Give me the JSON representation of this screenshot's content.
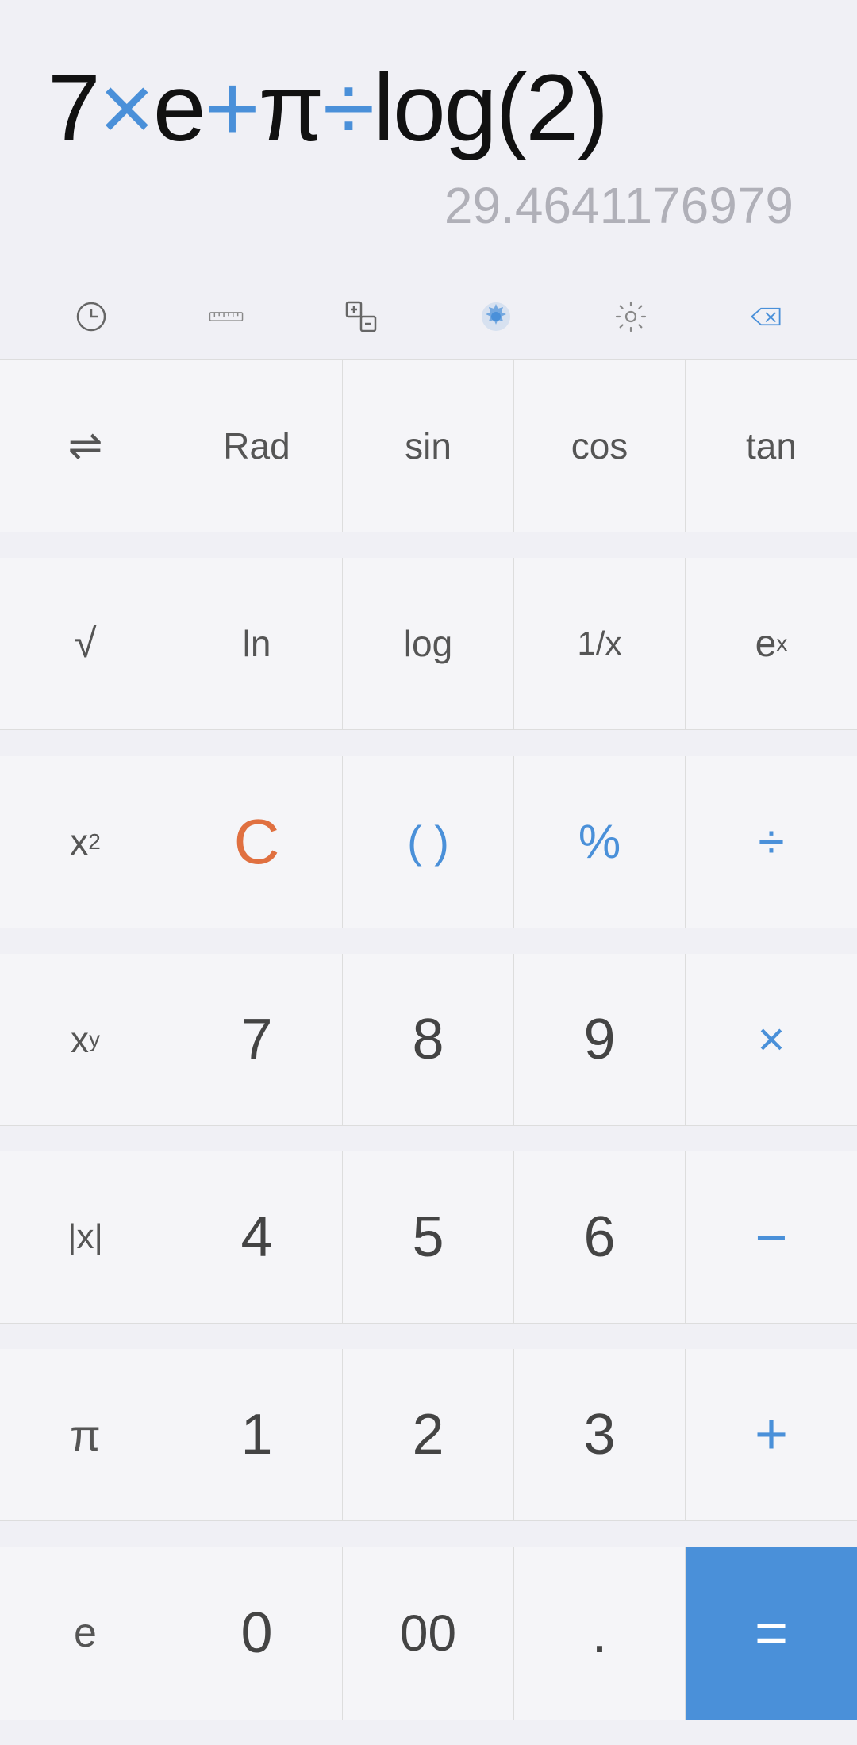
{
  "display": {
    "expression": "7×e+π÷log(2)",
    "result": "29.4641176979"
  },
  "toolbar": {
    "icons": [
      {
        "name": "history-icon",
        "label": "History"
      },
      {
        "name": "ruler-icon",
        "label": "Ruler/Unit"
      },
      {
        "name": "plusminus-icon",
        "label": "Plus Minus"
      },
      {
        "name": "theme-icon",
        "label": "Theme"
      },
      {
        "name": "settings-icon",
        "label": "Settings"
      },
      {
        "name": "backspace-icon",
        "label": "Backspace"
      }
    ]
  },
  "keyboard": {
    "rows": [
      [
        {
          "label": "⇌",
          "type": "symbol",
          "name": "convert-key"
        },
        {
          "label": "Rad",
          "type": "text",
          "name": "rad-key"
        },
        {
          "label": "sin",
          "type": "text",
          "name": "sin-key"
        },
        {
          "label": "cos",
          "type": "text",
          "name": "cos-key"
        },
        {
          "label": "tan",
          "type": "text",
          "name": "tan-key"
        }
      ],
      [
        {
          "label": "√",
          "type": "symbol",
          "name": "sqrt-key"
        },
        {
          "label": "ln",
          "type": "text",
          "name": "ln-key"
        },
        {
          "label": "log",
          "type": "text",
          "name": "log-key"
        },
        {
          "label": "1/x",
          "type": "text",
          "name": "reciprocal-key"
        },
        {
          "label": "eˣ",
          "type": "text",
          "name": "exp-key"
        }
      ],
      [
        {
          "label": "x²",
          "type": "symbol",
          "name": "square-key"
        },
        {
          "label": "C",
          "type": "clear",
          "name": "clear-key"
        },
        {
          "label": "( )",
          "type": "blue",
          "name": "paren-key"
        },
        {
          "label": "%",
          "type": "blue",
          "name": "percent-key"
        },
        {
          "label": "÷",
          "type": "blue",
          "name": "divide-key"
        }
      ],
      [
        {
          "label": "xʸ",
          "type": "symbol",
          "name": "power-key"
        },
        {
          "label": "7",
          "type": "number",
          "name": "seven-key"
        },
        {
          "label": "8",
          "type": "number",
          "name": "eight-key"
        },
        {
          "label": "9",
          "type": "number",
          "name": "nine-key"
        },
        {
          "label": "×",
          "type": "blue",
          "name": "multiply-key"
        }
      ],
      [
        {
          "label": "|x|",
          "type": "symbol",
          "name": "abs-key"
        },
        {
          "label": "4",
          "type": "number",
          "name": "four-key"
        },
        {
          "label": "5",
          "type": "number",
          "name": "five-key"
        },
        {
          "label": "6",
          "type": "number",
          "name": "six-key"
        },
        {
          "label": "−",
          "type": "blue",
          "name": "minus-key"
        }
      ],
      [
        {
          "label": "π",
          "type": "symbol",
          "name": "pi-key"
        },
        {
          "label": "1",
          "type": "number",
          "name": "one-key"
        },
        {
          "label": "2",
          "type": "number",
          "name": "two-key"
        },
        {
          "label": "3",
          "type": "number",
          "name": "three-key"
        },
        {
          "label": "+",
          "type": "blue",
          "name": "plus-key"
        }
      ],
      [
        {
          "label": "e",
          "type": "symbol",
          "name": "euler-key"
        },
        {
          "label": "0",
          "type": "number",
          "name": "zero-key"
        },
        {
          "label": "00",
          "type": "number",
          "name": "double-zero-key"
        },
        {
          "label": ".",
          "type": "number",
          "name": "decimal-key"
        },
        {
          "label": "=",
          "type": "equals",
          "name": "equals-key"
        }
      ]
    ]
  },
  "colors": {
    "blue": "#4a90d9",
    "orange": "#e07040",
    "bg": "#f0f0f5",
    "key_bg": "#f5f5f8",
    "border": "#ddd",
    "text_dark": "#111",
    "text_gray": "#555",
    "result_gray": "#b0b0b8"
  }
}
